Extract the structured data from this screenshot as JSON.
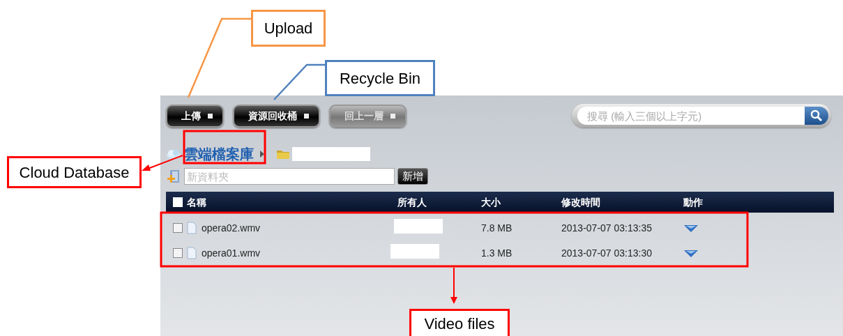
{
  "annotations": [
    {
      "label": "Upload",
      "color": "#f79646",
      "kind": "upload"
    },
    {
      "label": "Recycle Bin",
      "color": "#4f81bd",
      "kind": "recycle"
    },
    {
      "label": "Cloud Database",
      "color": "#ff0000",
      "kind": "cloud"
    },
    {
      "label": "Video files",
      "color": "#ff0000",
      "kind": "files"
    }
  ],
  "toolbar": [
    {
      "label": "上傳",
      "disabled": false
    },
    {
      "label": "資源回收桶",
      "disabled": false
    },
    {
      "label": "回上一層",
      "disabled": true
    }
  ],
  "search": {
    "placeholder": "搜尋 (輸入三個以上字元)"
  },
  "breadcrumb": {
    "root": "雲端檔案庫"
  },
  "new_folder": {
    "placeholder": "新資料夾",
    "button": "新增"
  },
  "table": {
    "select_all_checked": false,
    "columns": [
      "名稱",
      "所有人",
      "大小",
      "修改時間",
      "動作"
    ],
    "rows": [
      {
        "name": "opera02.wmv",
        "size": "7.8 MB",
        "modified": "2013-07-07 03:13:35",
        "checked": false
      },
      {
        "name": "opera01.wmv",
        "size": "1.3 MB",
        "modified": "2013-07-07 03:13:30",
        "checked": false
      }
    ]
  }
}
